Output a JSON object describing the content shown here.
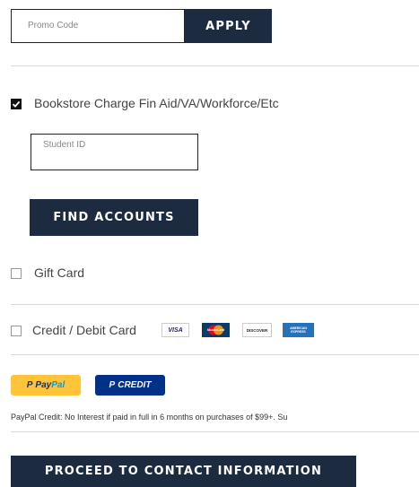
{
  "promo": {
    "placeholder": "Promo Code",
    "apply_label": "APPLY"
  },
  "payment_options": {
    "bookstore_charge": {
      "label": "Bookstore Charge Fin Aid/VA/Workforce/Etc",
      "checked": true,
      "student_id_placeholder": "Student ID",
      "find_accounts_label": "FIND ACCOUNTS"
    },
    "gift_card": {
      "label": "Gift Card",
      "checked": false
    },
    "credit_card": {
      "label": "Credit / Debit Card",
      "checked": false,
      "cards": [
        "visa-card-icon",
        "mastercard-card-icon",
        "discover-card-icon",
        "amex-card-icon"
      ],
      "visa_text": "VISA",
      "mastercard_text": "MasterCard",
      "discover_text": "DISCOVER",
      "amex_text": "AMERICAN EXPRESS"
    }
  },
  "paypal": {
    "paypal_prefix": "P",
    "paypal_pay": "Pay",
    "paypal_pal": "Pal",
    "credit_prefix": "P",
    "credit_label": "CREDIT",
    "note": "PayPal Credit: No Interest if paid in full in 6 months on purchases of $99+. Su",
    "paypal_color": "#ffc439",
    "credit_color": "#003087"
  },
  "proceed_label": "PROCEED TO CONTACT INFORMATION",
  "colors": {
    "button_bg": "#1c2b3f",
    "button_text": "#ffffff"
  }
}
